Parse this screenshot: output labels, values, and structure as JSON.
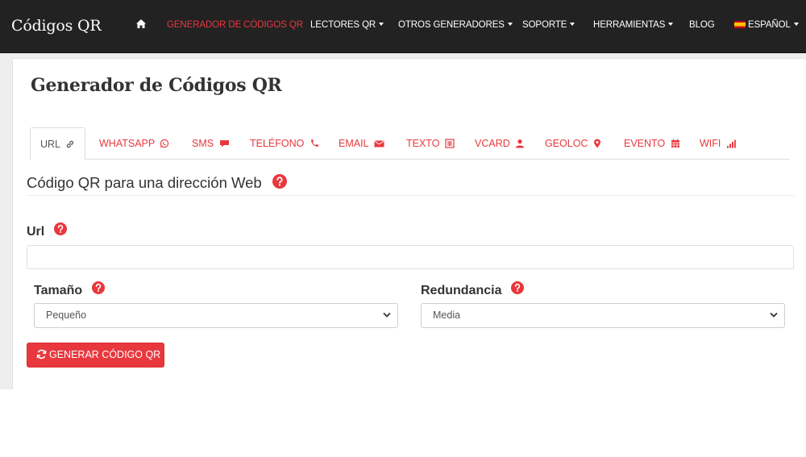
{
  "brand": "Códigos QR",
  "nav": {
    "items": [
      {
        "label": "GENERADOR DE CÓDIGOS QR"
      },
      {
        "label": "LECTORES QR"
      },
      {
        "label": "OTROS GENERADORES"
      },
      {
        "label": "SOPORTE"
      },
      {
        "label": "HERRAMIENTAS"
      },
      {
        "label": "BLOG"
      },
      {
        "label": "ESPAÑOL"
      }
    ]
  },
  "page_title": "Generador de Códigos QR",
  "tabs": [
    {
      "label": "URL",
      "icon": "link-icon"
    },
    {
      "label": "WHATSAPP",
      "icon": "whatsapp-icon"
    },
    {
      "label": "SMS",
      "icon": "comment-icon"
    },
    {
      "label": "TELÉFONO",
      "icon": "phone-icon"
    },
    {
      "label": "EMAIL",
      "icon": "envelope-icon"
    },
    {
      "label": "TEXTO",
      "icon": "text-box-icon"
    },
    {
      "label": "VCARD",
      "icon": "user-icon"
    },
    {
      "label": "GEOLOC",
      "icon": "map-marker-icon"
    },
    {
      "label": "EVENTO",
      "icon": "calendar-icon"
    },
    {
      "label": "WIFI",
      "icon": "signal-icon"
    }
  ],
  "section_title": "Código QR para una dirección Web",
  "form": {
    "url_label": "Url",
    "url_value": "",
    "size_label": "Tamaño",
    "size_value": "Pequeño",
    "redundancy_label": "Redundancia",
    "redundancy_value": "Media",
    "generate_label": "GENERAR CÓDIGO QR"
  },
  "colors": {
    "accent": "#e8383d",
    "navbar": "#222222"
  }
}
